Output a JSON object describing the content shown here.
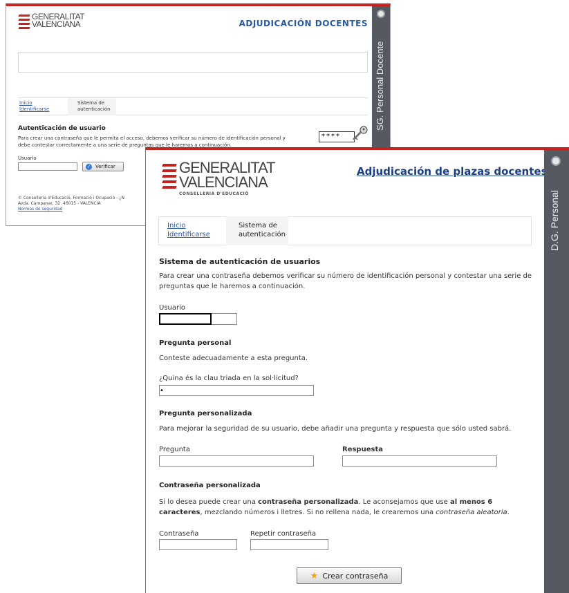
{
  "back_window": {
    "logo": {
      "line1": "GENERALITAT",
      "line2": "VALENCIANA"
    },
    "app_title": "ADJUDICACIÓN DOCENTES",
    "sidebar_text": "SG. Personal Docente",
    "breadcrumb": {
      "link1": "Inicio",
      "link2": "Identificarse",
      "current_line1": "Sistema de",
      "current_line2": "autenticación"
    },
    "heading": "Autenticación de usuario",
    "intro": "Para crear una contraseña que le permita el acceso, debemos verificar su número de identificación personal y debe contestar correctamente a una serie de preguntas que le haremos a continuación.",
    "user_label": "Usuario",
    "verify_button": "Verificar",
    "password_mask": "****",
    "footer": {
      "line1": "© Conselleria d'Educació, Formació i Ocupació - ¿N",
      "line2": "Avda. Campanar, 32. 46015 - VALENCIA",
      "link": "Normas de seguridad"
    }
  },
  "front_window": {
    "logo": {
      "line1": "GENERALITAT",
      "line2": "VALENCIANA",
      "sub": "CONSELLERIA D'EDUCACIÓ"
    },
    "app_title": "Adjudicación de plazas docentes",
    "sidebar_text": "D.G. Personal",
    "breadcrumb": {
      "link1": "Inicio",
      "link2": "Identificarse",
      "current_line1": "Sistema de",
      "current_line2": "autenticación"
    },
    "heading": "Sistema de autenticación de usuarios",
    "intro": "Para crear una contraseña debemos verificar su número de identificación personal y contestar una serie de preguntas que le haremos a continuación.",
    "user_label": "Usuario",
    "personal_question": {
      "heading": "Pregunta personal",
      "instruction": "Conteste adecuadamente a esta pregunta.",
      "question": "¿Quina és la clau triada en la sol·licitud?",
      "answer_value": "•"
    },
    "custom_question": {
      "heading": "Pregunta personalizada",
      "instruction": "Para mejorar la seguridad de su usuario, debe añadir una pregunta y respuesta que sólo usted sabrá.",
      "question_label": "Pregunta",
      "answer_label": "Respuesta"
    },
    "custom_password": {
      "heading": "Contraseña personalizada",
      "text_a": "Si lo desea puede crear una ",
      "text_b": "contraseña personalizada",
      "text_c": ". Le aconsejamos que use ",
      "text_d": "al menos 6 caracteres",
      "text_e": ", mezclando números i lletres. Si no rellena nada, le crearemos una ",
      "text_f": "contraseña aleatoria",
      "text_g": ".",
      "password_label": "Contraseña",
      "repeat_label": "Repetir contraseña"
    },
    "create_button": "Crear contraseña"
  },
  "colors": {
    "accent_red": "#c5231f",
    "link_blue": "#2a55aa",
    "title_blue": "#1a3f84",
    "sidebar_gray": "#555a60"
  }
}
